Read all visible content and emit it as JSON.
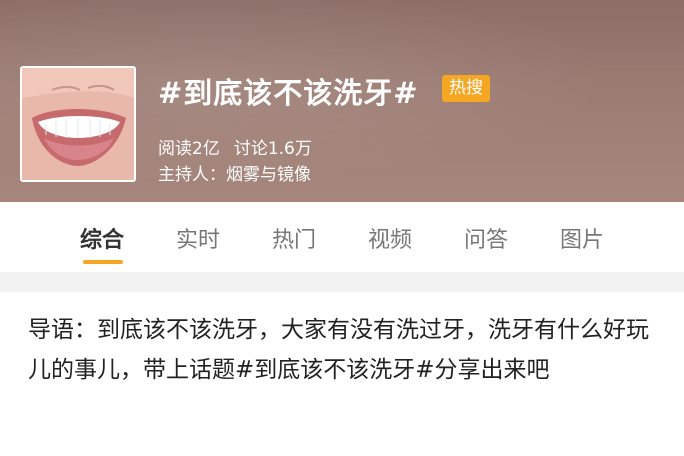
{
  "topic": {
    "title": "#到底该不该洗牙#",
    "badge": "热搜",
    "reads": "阅读2亿",
    "discussions": "讨论1.6万",
    "host": "主持人：烟雾与镜像"
  },
  "tabs": [
    {
      "label": "综合",
      "active": true
    },
    {
      "label": "实时",
      "active": false
    },
    {
      "label": "热门",
      "active": false
    },
    {
      "label": "视频",
      "active": false
    },
    {
      "label": "问答",
      "active": false
    },
    {
      "label": "图片",
      "active": false
    }
  ],
  "intro": {
    "text": "导语：到底该不该洗牙，大家有没有洗过牙，洗牙有什么好玩儿的事儿，带上话题#到底该不该洗牙#分享出来吧"
  },
  "colors": {
    "header_bg": "#9a7b72",
    "accent": "#f5a623"
  }
}
